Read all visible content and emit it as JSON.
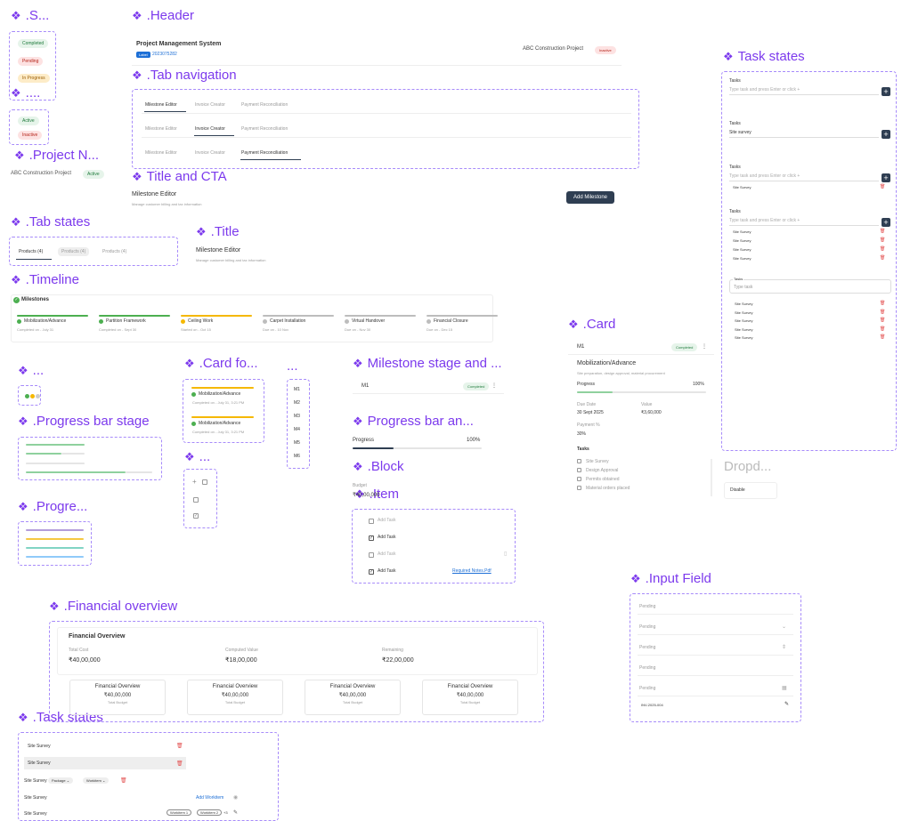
{
  "section_titles": {
    "status": ".S...",
    "dots1": "....",
    "project_name": ".Project N...",
    "header": ".Header",
    "tab_navigation": ".Tab navigation",
    "title_cta": "Title and CTA",
    "tab_states": ".Tab states",
    "title": ".Title",
    "timeline": ".Timeline",
    "dots2": "...",
    "card_fo": ".Card fo...",
    "dots3": "...",
    "milestone_stage": "Milestone stage and ...",
    "progress_bar_stage": ".Progress bar stage",
    "progress_bar_an": "Progress bar an...",
    "dots4": "...",
    "block": ".Block",
    "progre": ".Progre...",
    "item": ".Item",
    "financial_overview": ".Financial overview",
    "task_states_bottom": ".Task states",
    "task_states_right": "Task states",
    "card": ".Card",
    "dropdown": "Dropd...",
    "input_field": ".Input Field"
  },
  "status_badges": {
    "completed": "Completed",
    "pending": "Pending",
    "in_progress": "In Progress"
  },
  "active_badges": {
    "active": "Active",
    "inactive": "Inactive"
  },
  "project_name": {
    "name": "ABC Construction Project",
    "badge": "Active"
  },
  "header": {
    "title": "Project Management System",
    "badge": "Label",
    "id": "2023075282",
    "project": "ABC Construction Project",
    "status": "Inactive"
  },
  "tab_nav": {
    "row1": [
      "Milestone Editor",
      "Invoice Creator",
      "Payment Reconciliation"
    ],
    "row2": [
      "Milestone Editor",
      "Invoice Creator",
      "Payment Reconciliation"
    ],
    "row3": [
      "Milestone Editor",
      "Invoice Creator",
      "Payment Reconciliation"
    ]
  },
  "title_cta": {
    "title": "Milestone Editor",
    "subtitle": "Manage customer billing and tax information",
    "button": "Add Milestone"
  },
  "tab_states": [
    "Products (4)",
    "Products (4)",
    "Products (4)"
  ],
  "title_block": {
    "title": "Milestone Editor",
    "subtitle": "Manage customer billing and tax information"
  },
  "timeline": {
    "heading": "Milestones",
    "items": [
      {
        "name": "Mobilization/Advance",
        "sub": "Completed on - July 31",
        "color": "#4caf50"
      },
      {
        "name": "Partition Framework",
        "sub": "Completed on - Sept 30",
        "color": "#4caf50"
      },
      {
        "name": "Ceiling Work",
        "sub": "Started on - Oct 15",
        "color": "#f5b800"
      },
      {
        "name": "Carpet Installation",
        "sub": "Due on - 10 Nov",
        "color": "#bdbdbd"
      },
      {
        "name": "Virtual Handover",
        "sub": "Due on - Nov 30",
        "color": "#bdbdbd"
      },
      {
        "name": "Financial Closure",
        "sub": "Due on - Dec 15",
        "color": "#bdbdbd"
      }
    ]
  },
  "card_fo": [
    {
      "name": "Mobilization/Advance",
      "sub": "Completed on - July 31, 3:21 PM",
      "bar": "#f5b800"
    },
    {
      "name": "Mobilization/Advance",
      "sub": "Completed on - July 31, 3:21 PM",
      "bar": "#f5b800"
    }
  ],
  "milestone_list": [
    "M1",
    "M2",
    "M3",
    "M4",
    "M5",
    "M6"
  ],
  "milestone_stage": {
    "label": "M1",
    "badge": "Completed"
  },
  "progress_bar": {
    "label": "Progress",
    "value": "100%",
    "fraction": 0.32
  },
  "block": {
    "label": "Budget",
    "value": "₹40,00,000"
  },
  "items": [
    {
      "label": "Add Task",
      "checked": false,
      "extra": ""
    },
    {
      "label": "Add Task",
      "checked": true,
      "extra": ""
    },
    {
      "label": "Add Task",
      "checked": false,
      "extra": ""
    },
    {
      "label": "Add Task",
      "checked": true,
      "extra": "Required Notes.Pdf"
    }
  ],
  "card": {
    "id": "M1",
    "badge": "Completed",
    "title": "Mobilization/Advance",
    "desc": "Site preparation, design approval, material procurement",
    "progress_label": "Progress",
    "progress_value": "100%",
    "due_label": "Due Date",
    "due_value": "30 Sept 2025",
    "value_label": "Value",
    "value_value": "₹3,60,000",
    "payment_label": "Payment %",
    "payment_value": "30%",
    "tasks_label": "Tasks",
    "tasks": [
      "Site Survey",
      "Design Approval",
      "Permits obtained",
      "Material orders placed"
    ]
  },
  "dropdown": {
    "value": "Disable"
  },
  "task_states_right": {
    "label": "Tasks",
    "placeholder": "Type task and press Enter or click +",
    "filled_value": "Site survey",
    "task_item": "Site Survey",
    "short_placeholder": "Type task"
  },
  "input_field": {
    "values": [
      "Pending",
      "Pending",
      "Pending",
      "Pending",
      "Pending"
    ],
    "final": "INV-2025-004"
  },
  "financial_overview": {
    "title": "Financial Overview",
    "stats": [
      {
        "label": "Total Cost",
        "value": "₹40,00,000"
      },
      {
        "label": "Computed Value",
        "value": "₹18,00,000"
      },
      {
        "label": "Remaining",
        "value": "₹22,00,000"
      }
    ],
    "cards": [
      {
        "title": "Financial Overview",
        "value": "₹40,00,000",
        "sub": "Total Budget"
      },
      {
        "title": "Financial Overview",
        "value": "₹40,00,000",
        "sub": "Total Budget"
      },
      {
        "title": "Financial Overview",
        "value": "₹40,00,000",
        "sub": "Total Budget"
      },
      {
        "title": "Financial Overview",
        "value": "₹40,00,000",
        "sub": "Total Budget"
      }
    ]
  },
  "task_states_bottom": {
    "task": "Site Survey",
    "package": "Package",
    "workitem": "Workitem",
    "add_workitem": "Add Workitem",
    "chip1": "Workitem 1",
    "chip2": "Workitem 2",
    "more": "+3"
  }
}
